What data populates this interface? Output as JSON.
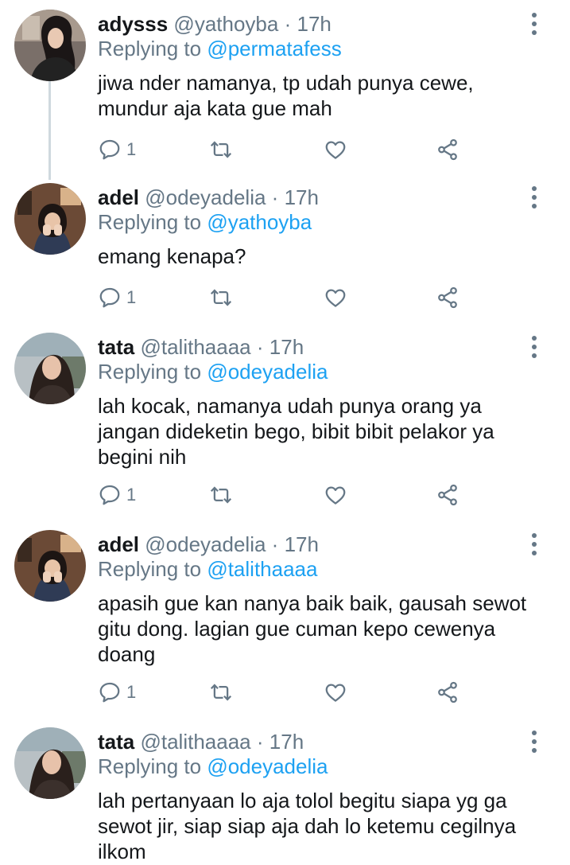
{
  "tweets": [
    {
      "name": "adysss",
      "handle": "@yathoyba",
      "dot": "·",
      "time": "17h",
      "reply_prefix": "Replying to",
      "reply_to": "@permatafess",
      "text": "jiwa nder namanya, tp udah punya cewe,\nmundur aja kata gue mah",
      "reply_count": "1"
    },
    {
      "name": "adel",
      "handle": "@odeyadelia",
      "dot": "·",
      "time": "17h",
      "reply_prefix": "Replying to",
      "reply_to": "@yathoyba",
      "text": "emang kenapa?",
      "reply_count": "1"
    },
    {
      "name": "tata",
      "handle": "@talithaaaa",
      "dot": "·",
      "time": "17h",
      "reply_prefix": "Replying to",
      "reply_to": "@odeyadelia",
      "text": "lah kocak, namanya udah punya orang ya\njangan dideketin bego, bibit bibit pelakor ya\nbegini nih",
      "reply_count": "1"
    },
    {
      "name": "adel",
      "handle": "@odeyadelia",
      "dot": "·",
      "time": "17h",
      "reply_prefix": "Replying to",
      "reply_to": "@talithaaaa",
      "text": "apasih gue kan nanya baik baik, gausah sewot\ngitu dong. lagian gue cuman kepo cewenya\ndoang",
      "reply_count": "1"
    },
    {
      "name": "tata",
      "handle": "@talithaaaa",
      "dot": "·",
      "time": "17h",
      "reply_prefix": "Replying to",
      "reply_to": "@odeyadelia",
      "text": "lah pertanyaan lo aja tolol begitu siapa yg ga\nsewot jir, siap siap aja dah lo ketemu cegilnya\nilkom",
      "reply_count": ""
    }
  ],
  "icons": {
    "reply": "reply-icon",
    "retweet": "retweet-icon",
    "like": "like-icon",
    "share": "share-icon",
    "more": "more-options-icon"
  },
  "colors": {
    "text": "#14171a",
    "secondary": "#657786",
    "link": "#1da1f2",
    "thread_line": "#cfd9de"
  }
}
